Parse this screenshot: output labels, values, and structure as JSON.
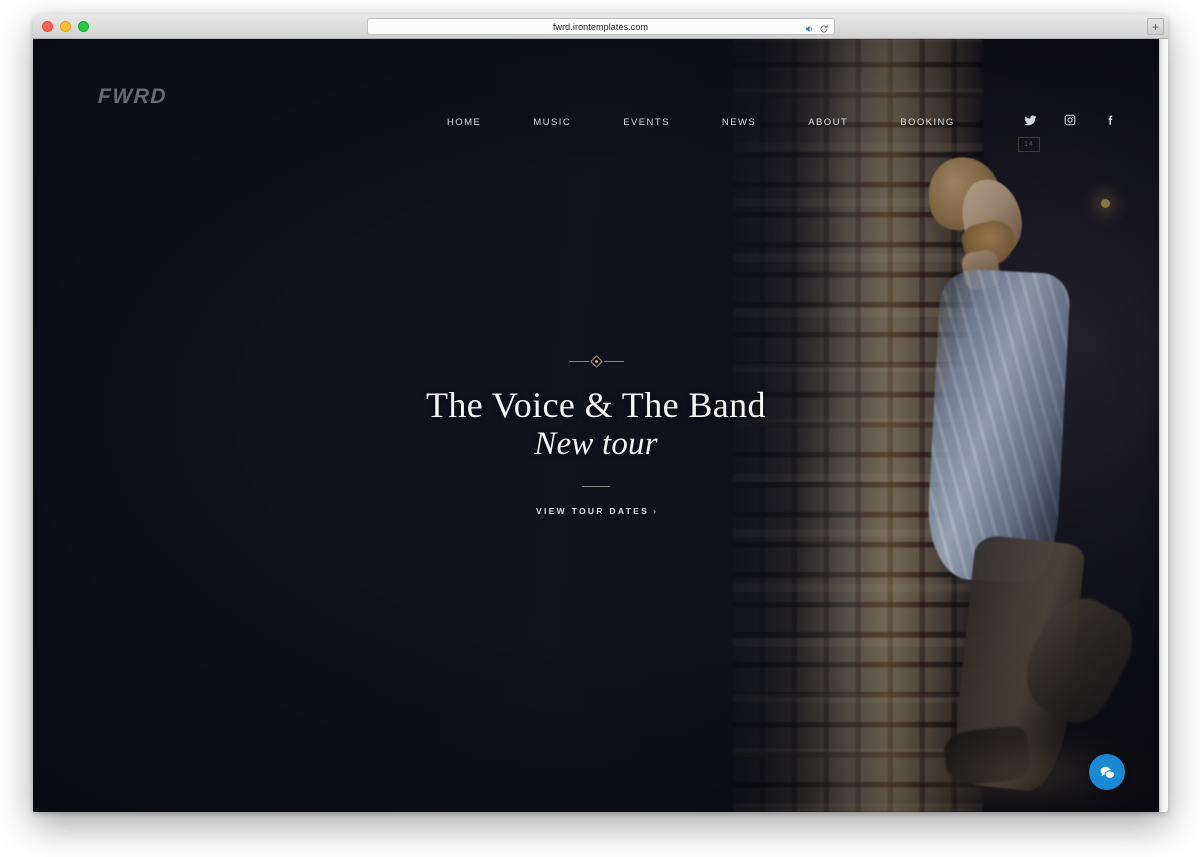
{
  "browser": {
    "url": "fwrd.irontemplates.com",
    "traffic_lights": [
      "close",
      "minimize",
      "zoom"
    ],
    "speaker_icon": "speaker-icon",
    "reload_icon": "reload-icon",
    "new_tab_label": "+"
  },
  "site": {
    "brand": "FWRD",
    "nav": [
      {
        "label": "HOME"
      },
      {
        "label": "MUSIC"
      },
      {
        "label": "EVENTS"
      },
      {
        "label": "NEWS"
      },
      {
        "label": "ABOUT"
      },
      {
        "label": "BOOKING"
      }
    ],
    "social": [
      {
        "name": "twitter-icon"
      },
      {
        "name": "instagram-icon"
      },
      {
        "name": "facebook-icon"
      }
    ],
    "hero": {
      "ornament": "diamond-ornament",
      "title_line1": "The Voice & The Band",
      "title_line2": "New tour",
      "cta_label": "VIEW TOUR DATES",
      "cta_chevron": "›",
      "wall_plate_text": "14"
    },
    "chat": {
      "icon": "chat-bubbles-icon"
    }
  },
  "colors": {
    "page_background": "#12141f",
    "hero_title": "#f7f6f4",
    "nav_text": "#e7e8ec",
    "brand_text": "#6e717c",
    "ornament_gold": "#ab9070",
    "chat_blue": "#1b88d4"
  }
}
